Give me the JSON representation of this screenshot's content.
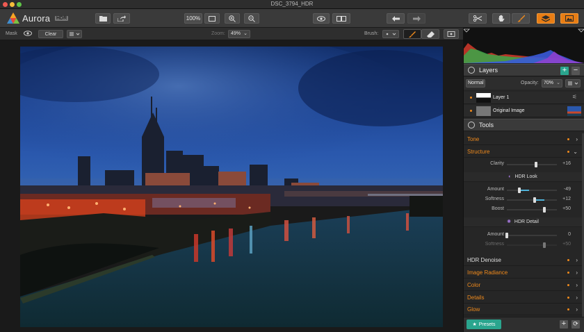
{
  "window": {
    "title": "DSC_3794_HDR"
  },
  "app": {
    "name": "Aurora",
    "badge": "HDR"
  },
  "toolbar": {
    "zoom_label": "100%"
  },
  "optbar": {
    "mask_label": "Mask",
    "clear_label": "Clear",
    "zoom_label": "Zoom:",
    "zoom_value": "49%",
    "brush_label": "Brush:"
  },
  "layers": {
    "title": "Layers",
    "blend_mode": "Normal",
    "opacity_label": "Opacity:",
    "opacity_value": "70%",
    "items": [
      {
        "name": "Layer 1"
      },
      {
        "name": "Original Image"
      }
    ]
  },
  "tools": {
    "title": "Tools",
    "tone": "Tone",
    "structure": "Structure",
    "clarity": {
      "label": "Clarity",
      "value": "+16",
      "level": 0.58
    },
    "hdr_look": {
      "title": "HDR Look",
      "amount": {
        "label": "Amount",
        "value": "-49",
        "level": 0.255
      },
      "softness": {
        "label": "Softness",
        "value": "+12",
        "level": 0.56
      },
      "boost": {
        "label": "Boost",
        "value": "+50",
        "level": 0.75
      }
    },
    "hdr_detail": {
      "title": "HDR Detail",
      "amount": {
        "label": "Amount",
        "value": "0",
        "level": 0
      },
      "softness": {
        "label": "Softness",
        "value": "+50",
        "level": 0.75
      }
    },
    "sections": [
      "HDR Denoise",
      "Image Radiance",
      "Color",
      "Details",
      "Glow"
    ]
  },
  "presets": {
    "label": "Presets"
  },
  "colors": {
    "accent": "#f08a1c",
    "teal": "#2aa58e",
    "slider": "#4fb3d9"
  }
}
